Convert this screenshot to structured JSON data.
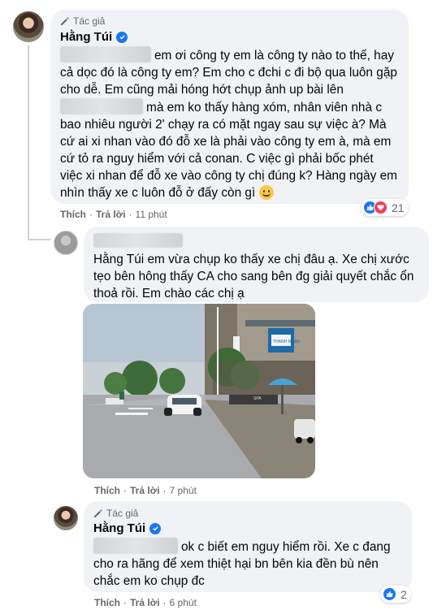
{
  "comment1": {
    "author_badge": "Tác giả",
    "author_name": "Hằng Túi",
    "text_before": "em ơi công ty em là công ty nào to thế, hay cả dọc đó là công ty em? Em cho c đchi c đi bộ qua luôn gặp cho dễ. Em cũng mải hóng hớt chụp ảnh up bài lên",
    "text_after": "mà em ko thấy hàng xóm, nhân viên nhà c bao nhiêu người 2' chạy ra có mặt ngay sau sự việc à? Mà cứ ai xi nhan vào đó đỗ xe là phải vào công ty em à, mà em cứ tỏ ra nguy hiểm với cả conan. C việc gì phải bốc phét việc xi nhan để đỗ xe vào công ty chị đúng k? Hàng ngày em nhìn thấy xe c luôn đỗ ở đấy còn gì",
    "like_label": "Thích",
    "reply_label": "Trả lời",
    "time": "11 phút",
    "reaction_count": "21"
  },
  "comment2": {
    "author_name": "Hằng Túi",
    "text": "em vừa chụp ko thấy xe chị đâu ạ. Xe chị xước tẹo bên hông thấy CA cho sang bên đg giải quyết chắc ổn thoả rồi. Em chào các chị ạ",
    "like_label": "Thích",
    "reply_label": "Trả lời",
    "time": "7 phút",
    "photo": {
      "sign_text": "THANH NHÀN",
      "storefront_text": "SPA"
    }
  },
  "comment3": {
    "author_badge": "Tác giả",
    "author_name": "Hằng Túi",
    "text": "ok c biết em nguy hiểm rồi. Xe c đang cho ra hãng để xem thiệt hại bn bên kia đền bù nên chắc em ko chụp đc",
    "like_label": "Thích",
    "reply_label": "Trả lời",
    "time": "6 phút",
    "reaction_count": "2"
  },
  "colors": {
    "bubble": "#f0f2f5",
    "accent": "#1877f2",
    "muted_text": "#65676b",
    "love": "#f33e58"
  }
}
